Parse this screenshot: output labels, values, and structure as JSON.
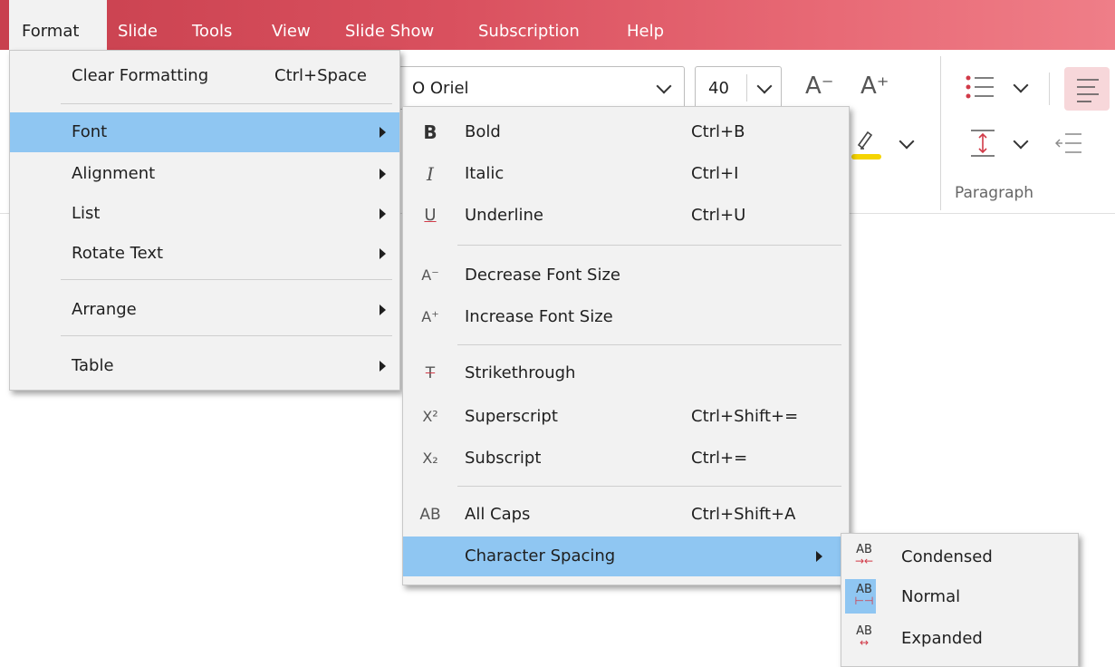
{
  "menubar": {
    "items": [
      "Format",
      "Slide",
      "Tools",
      "View",
      "Slide Show",
      "Subscription",
      "Help"
    ]
  },
  "ribbon": {
    "font_name": "O Oriel",
    "font_size": "40",
    "decrease_font_glyph": "A⁻",
    "increase_font_glyph": "A⁺",
    "paragraph_label": "Paragraph"
  },
  "format_menu": {
    "clear_formatting": {
      "label": "Clear Formatting",
      "shortcut": "Ctrl+Space"
    },
    "font": "Font",
    "alignment": "Alignment",
    "list": "List",
    "rotate_text": "Rotate Text",
    "arrange": "Arrange",
    "table": "Table"
  },
  "font_menu": {
    "bold": {
      "icon": "B",
      "label": "Bold",
      "shortcut": "Ctrl+B"
    },
    "italic": {
      "icon": "I",
      "label": "Italic",
      "shortcut": "Ctrl+I"
    },
    "underline": {
      "icon": "U",
      "label": "Underline",
      "shortcut": "Ctrl+U"
    },
    "decrease": {
      "icon": "A⁻",
      "label": "Decrease Font Size"
    },
    "increase": {
      "icon": "A⁺",
      "label": "Increase Font Size"
    },
    "strikethrough": {
      "icon": "T",
      "label": "Strikethrough"
    },
    "superscript": {
      "icon": "X²",
      "label": "Superscript",
      "shortcut": "Ctrl+Shift+="
    },
    "subscript": {
      "icon": "X₂",
      "label": "Subscript",
      "shortcut": "Ctrl+="
    },
    "all_caps": {
      "icon": "AB",
      "label": "All Caps",
      "shortcut": "Ctrl+Shift+A"
    },
    "character_spacing": "Character Spacing"
  },
  "spacing_menu": {
    "icon_text": "AB",
    "condensed": "Condensed",
    "normal": "Normal",
    "expanded": "Expanded"
  },
  "colors": {
    "menubar_start": "#c8404e",
    "menubar_end": "#ef7e88",
    "highlight": "#8fc6f2",
    "accent": "#d13a48"
  }
}
